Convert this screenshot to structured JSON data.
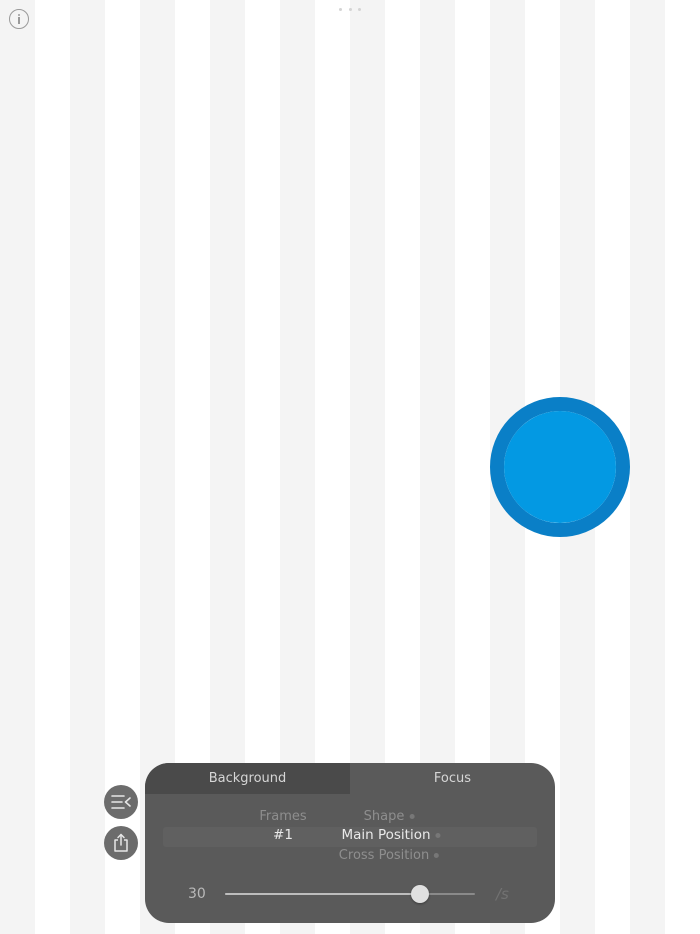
{
  "window_dots": [
    "•",
    "•",
    "•"
  ],
  "panel": {
    "tabs": [
      {
        "label": "Background",
        "active": true
      },
      {
        "label": "Focus",
        "active": false
      }
    ],
    "picker": {
      "left_column": {
        "above": "",
        "previous": "Frames",
        "selected": "#1",
        "next": ""
      },
      "right_column": {
        "above": "",
        "previous": "Shape",
        "selected": "Main Position",
        "next": "Cross Position",
        "below": ""
      }
    },
    "slider": {
      "value": "30",
      "unit": "/s",
      "level": 0.78
    }
  },
  "colors": {
    "stripe_light": "#ffffff",
    "stripe_dark": "#f4f4f4",
    "ball_fill": "#0399e3",
    "ball_ring": "#0a7fc7",
    "panel_bg": "#5a5a5a",
    "button_bg": "#6c6c6c"
  },
  "icons": {
    "info": "info-icon",
    "menu": "list-collapse-icon",
    "share": "share-icon"
  }
}
